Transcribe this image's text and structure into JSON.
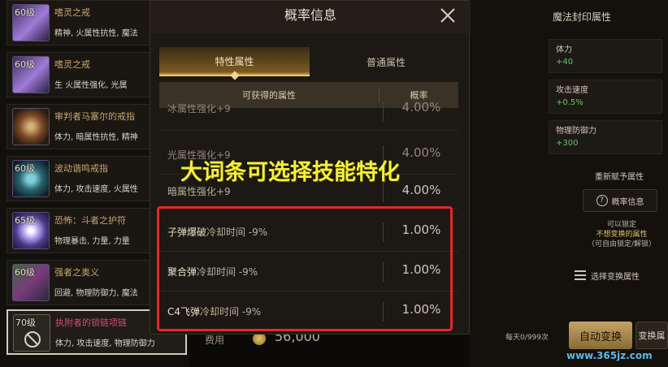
{
  "items": [
    {
      "level": "60级",
      "name": "嗜灵之戒",
      "attrs": "精神, 火属性抗性, 魔法"
    },
    {
      "level": "60级",
      "name": "嗜灵之戒",
      "attrs": "生      火属性强化, 光属"
    },
    {
      "level": "",
      "name": "审判者马塞尔的戒指",
      "attrs": "体力, 暗属性抗性, 精神"
    },
    {
      "level": "60级",
      "name": "波动谐鸣戒指",
      "attrs": "体力, 攻击速度, 火属性"
    },
    {
      "level": "65级",
      "name": "恐怖：斗者之护符",
      "attrs": "物理暴击, 力量, 力量"
    },
    {
      "level": "60级",
      "name": "强者之奥义",
      "attrs": "回避, 物理防御力, 魔法"
    },
    {
      "level": "70级",
      "name": "执附者的锁链项链",
      "attrs": "体力, 攻击速度, 物理防御力"
    }
  ],
  "modal": {
    "title": "概率信息",
    "tabs": {
      "special": "特性属性",
      "normal": "普通属性"
    },
    "columns": {
      "attr": "可获得的属性",
      "prob": "概率"
    },
    "rows": [
      {
        "highlight": "",
        "rest": "冰属性强化+9",
        "pct": "4.00%"
      },
      {
        "highlight": "",
        "rest": "光属性强化+9",
        "pct": "4.00%"
      },
      {
        "highlight": "",
        "rest": "暗属性强化+9",
        "pct": "4.00%"
      },
      {
        "highlight": "子弹爆破",
        "rest": "冷却时间 -9%",
        "pct": "1.00%"
      },
      {
        "highlight": "聚合弹",
        "rest": "冷却时间 -9%",
        "pct": "1.00%"
      },
      {
        "highlight": "C4飞弹",
        "rest": "冷却时间 -9%",
        "pct": "1.00%"
      }
    ]
  },
  "overlay_caption": "大词条可选择技能特化",
  "right_panel": {
    "title": "魔法封印属性",
    "stats": [
      {
        "label": "体力",
        "value": "+40"
      },
      {
        "label": "攻击速度",
        "value": "+0.5%"
      },
      {
        "label": "物理防御力",
        "value": "+300"
      }
    ],
    "reroll_label": "重新赋予属性",
    "prob_button": "概率信息",
    "lock_note": [
      "可以锁定",
      "不想变换的属性",
      "（可自由锁定/解锁）"
    ],
    "select_button": "选择变换属性",
    "daily": "每天0/999次",
    "auto_button": "自动变换",
    "swap_button": "变换属"
  },
  "cost": {
    "label": "费用",
    "value": "56,000"
  },
  "watermark": "www.365jz.com",
  "colors": {
    "accent_gold": "#e9c46a",
    "highlight_red": "#e8262b",
    "caption_yellow": "#f3f03a",
    "stat_green": "#61c66a"
  }
}
